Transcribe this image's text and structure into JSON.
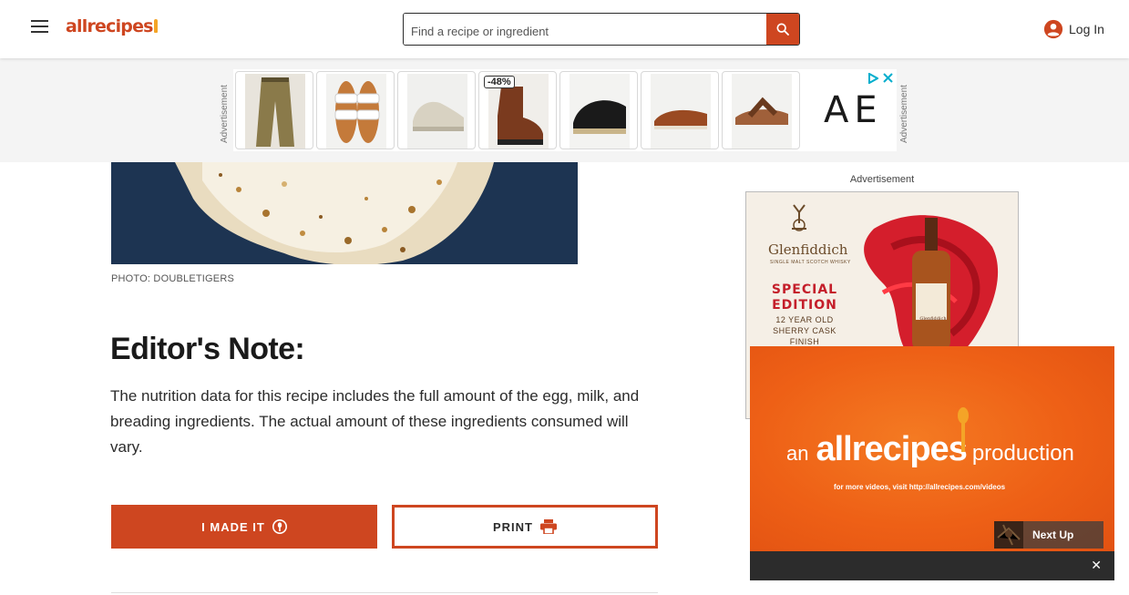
{
  "header": {
    "logo_text": "allrecipes",
    "search_placeholder": "Find a recipe or ingredient",
    "login_label": "Log In",
    "menu_icon": "hamburger-menu-icon",
    "search_icon": "search-icon",
    "account_icon": "account-circle-icon"
  },
  "ad_banner": {
    "label": "Advertisement",
    "discount_badge": "-48%",
    "brand_logo": "AE",
    "products": [
      "cargo-pants",
      "white-sandals",
      "sneakers",
      "chelsea-boots",
      "black-sandals",
      "boat-shoes",
      "flip-flops"
    ]
  },
  "article": {
    "photo_credit": "PHOTO: DOUBLETIGERS",
    "editor_note_title": "Editor's Note:",
    "editor_note_body": "The nutrition data for this recipe includes the full amount of the egg, milk, and breading ingredients. The actual amount of these ingredients consumed will vary.",
    "made_it_label": "I MADE IT",
    "print_label": "PRINT"
  },
  "sidebar_ad": {
    "label": "Advertisement",
    "brand": "Glenfiddich",
    "brand_sub": "SINGLE MALT SCOTCH WHISKY",
    "edition_line1": "SPECIAL",
    "edition_line2": "EDITION",
    "detail_line1": "12 YEAR OLD",
    "detail_line2": "SHERRY CASK",
    "detail_line3": "FINISH",
    "bottle_label": "Glenfiddich"
  },
  "video_player": {
    "prefix": "an",
    "brand": "allrecipes",
    "suffix": "production",
    "subtitle": "for more videos, visit http://allrecipes.com/videos",
    "next_up_label": "Next Up",
    "close_symbol": "✕"
  },
  "colors": {
    "brand_orange": "#ce4620",
    "video_orange": "#ed6219",
    "accent_yellow": "#f4a427"
  }
}
